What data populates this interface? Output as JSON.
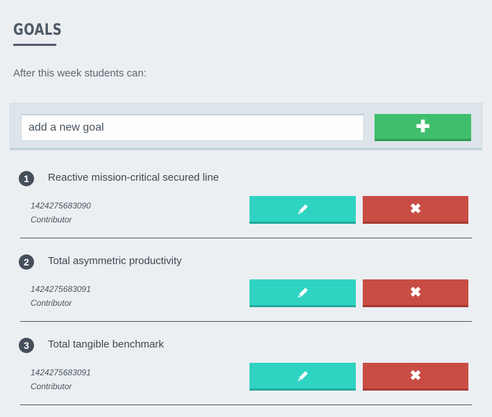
{
  "header": {
    "title": "GOALS",
    "subtitle": "After this week students can:"
  },
  "add_goal": {
    "placeholder": "add a new goal",
    "add_icon": "plus-icon"
  },
  "goals": [
    {
      "number": "1",
      "text": "Reactive mission-critical secured line",
      "id": "1424275683090",
      "role": "Contributor",
      "edit_icon": "pencil-icon",
      "delete_icon": "close-icon"
    },
    {
      "number": "2",
      "text": "Total asymmetric productivity",
      "id": "1424275683091",
      "role": "Contributor",
      "edit_icon": "pencil-icon",
      "delete_icon": "close-icon"
    },
    {
      "number": "3",
      "text": "Total tangible benchmark",
      "id": "1424275683091",
      "role": "Contributor",
      "edit_icon": "pencil-icon",
      "delete_icon": "close-icon"
    }
  ],
  "colors": {
    "background": "#ebeff2",
    "add_button": "#3fbf6c",
    "edit_button": "#2fd3c2",
    "delete_button": "#c94d44",
    "number_badge": "#454f5a"
  }
}
